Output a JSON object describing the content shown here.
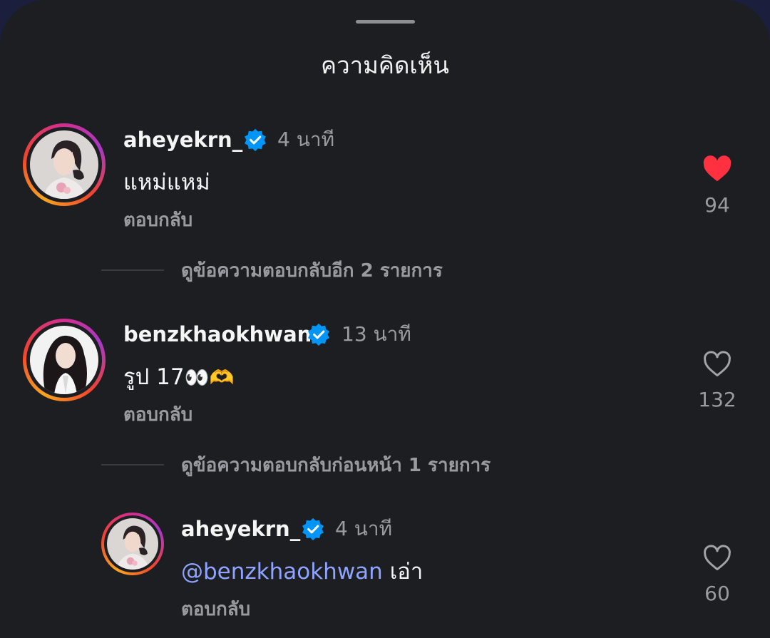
{
  "sheet": {
    "title": "ความคิดเห็น"
  },
  "comments": [
    {
      "username": "aheyekrn_",
      "time": "4 นาที",
      "text": "แหม่แหม่",
      "reply_label": "ตอบกลับ",
      "likes": "94",
      "liked": true,
      "more_replies": "ดูข้อความตอบกลับอีก 2 รายการ"
    },
    {
      "username": "benzkhaokhwan",
      "time": "13 นาที",
      "text": "รูป 17",
      "emoji": "👀🫶",
      "reply_label": "ตอบกลับ",
      "likes": "132",
      "liked": false,
      "more_replies": "ดูข้อความตอบกลับก่อนหน้า 1 รายการ"
    },
    {
      "username": "aheyekrn_",
      "time": "4 นาที",
      "mention": "@benzkhaokhwan",
      "text": "เอ่า",
      "reply_label": "ตอบกลับ",
      "likes": "60",
      "liked": false
    }
  ],
  "colors": {
    "like_red": "#ff3040",
    "verified_blue": "#0095f6",
    "mention": "#8ea4ff"
  }
}
